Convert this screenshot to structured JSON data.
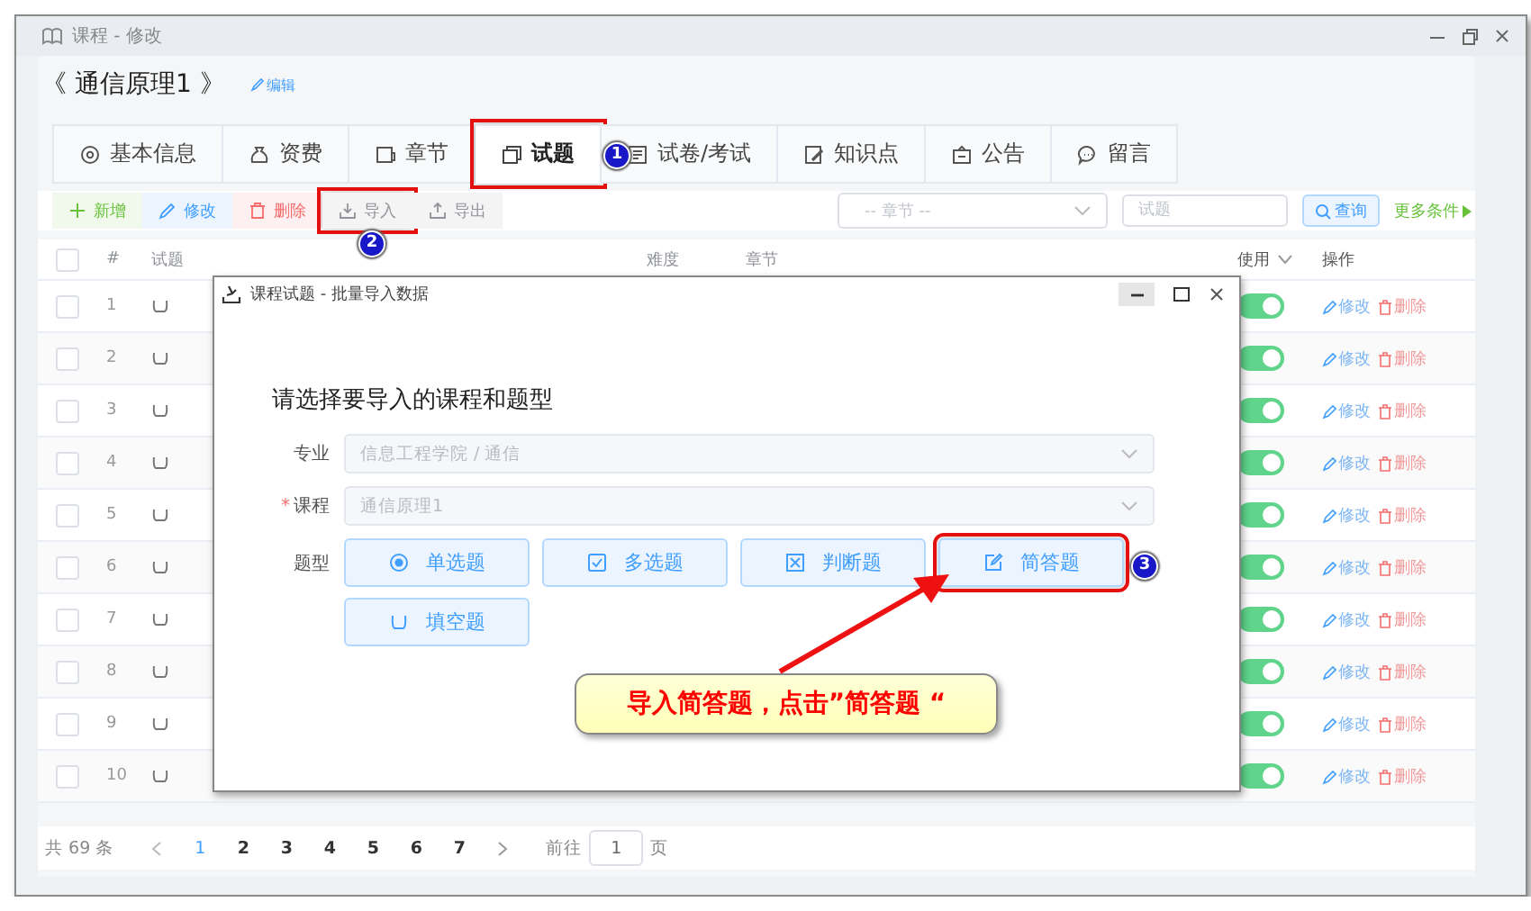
{
  "window": {
    "title": "课程 - 修改"
  },
  "course": {
    "title": "《 通信原理1 》",
    "edit_link": "编辑"
  },
  "tabs": [
    {
      "label": "基本信息",
      "selected": false
    },
    {
      "label": "资费",
      "selected": false
    },
    {
      "label": "章节",
      "selected": false
    },
    {
      "label": "试题",
      "selected": true,
      "highlighted": true,
      "marker": "1"
    },
    {
      "label": "试卷/考试",
      "selected": false
    },
    {
      "label": "知识点",
      "selected": false
    },
    {
      "label": "公告",
      "selected": false
    },
    {
      "label": "留言",
      "selected": false
    }
  ],
  "toolbar": {
    "buttons": [
      {
        "label": "新增",
        "kind": "add"
      },
      {
        "label": "修改",
        "kind": "edit"
      },
      {
        "label": "删除",
        "kind": "delete"
      },
      {
        "label": "导入",
        "kind": "import",
        "highlighted": true,
        "marker": "2"
      },
      {
        "label": "导出",
        "kind": "export"
      }
    ],
    "chapter_select": {
      "placeholder": "-- 章节 --"
    },
    "search": {
      "placeholder": "试题"
    },
    "search_button": "查询",
    "more_link": "更多条件"
  },
  "table": {
    "select_all_checked": false,
    "columns": [
      "#",
      "试题",
      "难度",
      "章节",
      "使用",
      "操作"
    ],
    "rows": [
      {
        "checked": false,
        "number": "1",
        "enabled": true,
        "edit": "修改",
        "delete": "删除"
      },
      {
        "checked": false,
        "number": "2",
        "enabled": true,
        "edit": "修改",
        "delete": "删除"
      },
      {
        "checked": false,
        "number": "3",
        "enabled": true,
        "edit": "修改",
        "delete": "删除"
      },
      {
        "checked": false,
        "number": "4",
        "enabled": true,
        "edit": "修改",
        "delete": "删除"
      },
      {
        "checked": false,
        "number": "5",
        "enabled": true,
        "edit": "修改",
        "delete": "删除"
      },
      {
        "checked": false,
        "number": "6",
        "enabled": true,
        "edit": "修改",
        "delete": "删除"
      },
      {
        "checked": false,
        "number": "7",
        "enabled": true,
        "edit": "修改",
        "delete": "删除"
      },
      {
        "checked": false,
        "number": "8",
        "enabled": true,
        "edit": "修改",
        "delete": "删除"
      },
      {
        "checked": false,
        "number": "9",
        "enabled": true,
        "edit": "修改",
        "delete": "删除"
      },
      {
        "checked": false,
        "number": "10",
        "enabled": true,
        "edit": "修改",
        "delete": "删除"
      }
    ]
  },
  "pagination": {
    "total": "共 69 条",
    "pages": [
      {
        "label": "1",
        "selected": true
      },
      {
        "label": "2",
        "selected": false
      },
      {
        "label": "3",
        "selected": false
      },
      {
        "label": "4",
        "selected": false
      },
      {
        "label": "5",
        "selected": false
      },
      {
        "label": "6",
        "selected": false
      },
      {
        "label": "7",
        "selected": false
      }
    ],
    "goto_label": "前往",
    "goto_value": "1",
    "page_unit": "页"
  },
  "dialog": {
    "title": "课程试题 - 批量导入数据",
    "heading": "请选择要导入的课程和题型",
    "fields": [
      {
        "label": "专业",
        "value": "信息工程学院 / 通信",
        "disabled": true
      },
      {
        "label": "课程",
        "required_mark": "*",
        "value": "通信原理1",
        "disabled": true
      }
    ],
    "type_label": "题型",
    "types": [
      {
        "label": "单选题",
        "highlighted": false
      },
      {
        "label": "多选题",
        "highlighted": false
      },
      {
        "label": "判断题",
        "highlighted": false
      },
      {
        "label": "简答题",
        "highlighted": true,
        "marker": "3"
      },
      {
        "label": "填空题",
        "highlighted": false
      }
    ]
  },
  "callout": {
    "text": "导入简答题，点击”简答题 “"
  }
}
